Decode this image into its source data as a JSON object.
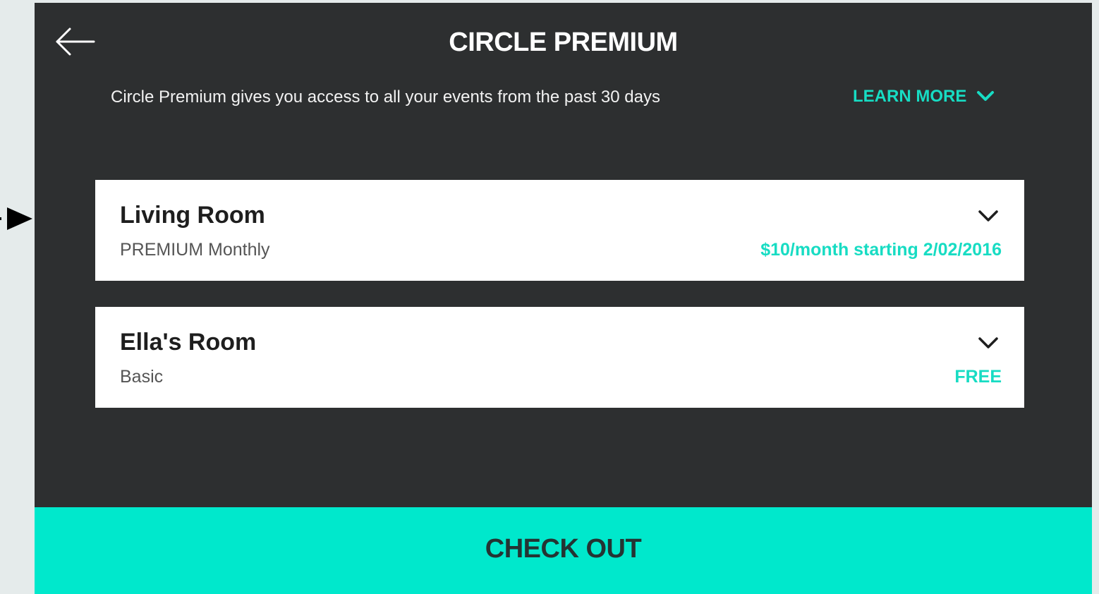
{
  "header": {
    "back_icon": "arrow-left-icon",
    "title": "CIRCLE PREMIUM",
    "subtitle": "Circle Premium gives you access to all your events from the past 30 days",
    "learn_more_label": "LEARN MORE",
    "learn_more_icon": "chevron-down-icon"
  },
  "devices": [
    {
      "name": "Living Room",
      "plan": "PREMIUM Monthly",
      "price": "$10/month starting 2/02/2016",
      "icon": "chevron-down-icon"
    },
    {
      "name": "Ella's Room",
      "plan": "Basic",
      "price": "FREE",
      "icon": "chevron-down-icon"
    }
  ],
  "checkout": {
    "label": "CHECK OUT"
  },
  "colors": {
    "panel_background": "#2d2f30",
    "accent": "#17dcc3",
    "checkout_background": "#00e8cc",
    "page_background": "#e5ebeb"
  },
  "annotation": {
    "icon": "pointer-arrow-icon"
  }
}
